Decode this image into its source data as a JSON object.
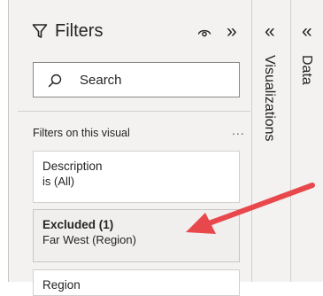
{
  "filters_pane": {
    "title": "Filters",
    "search": {
      "placeholder": "Search"
    },
    "section_label": "Filters on this visual",
    "more_label": "...",
    "cards": [
      {
        "title": "Description",
        "subtitle": "is (All)"
      },
      {
        "title": "Excluded (1)",
        "subtitle": "Far West (Region)"
      },
      {
        "title": "Region",
        "subtitle": ""
      }
    ]
  },
  "side_panes": [
    {
      "label": "Visualizations"
    },
    {
      "label": "Data"
    }
  ],
  "icons": {
    "filter": "funnel-icon",
    "visibility": "eye-icon",
    "collapse": "double-chevron-right",
    "expand": "double-chevron-left",
    "search": "magnifier-icon",
    "more": "ellipsis-icon"
  },
  "colors": {
    "pane_background": "#f3f2f1",
    "card_background": "#ffffff",
    "selected_card_background": "#f0efee",
    "annotation_arrow": "#e8484c"
  }
}
